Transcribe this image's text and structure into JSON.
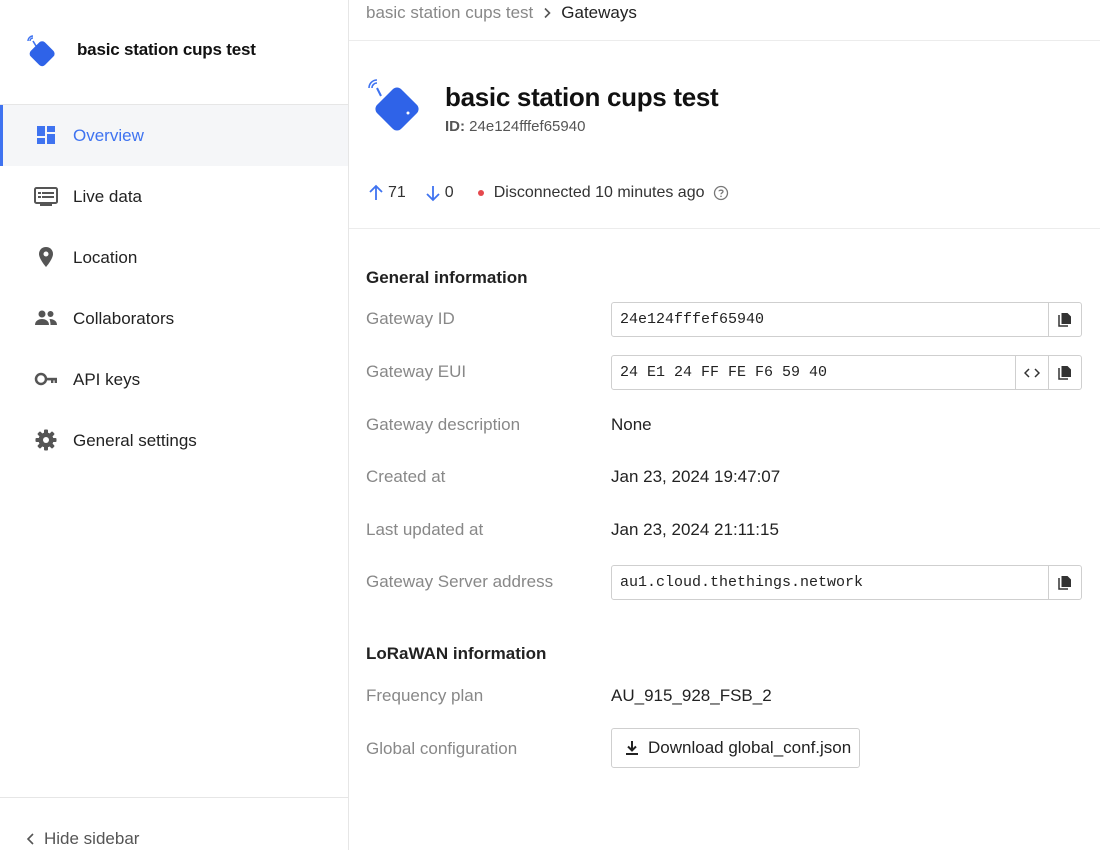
{
  "sidebar": {
    "title": "basic station cups test",
    "items": [
      {
        "label": "Overview",
        "icon": "overview-icon",
        "active": true
      },
      {
        "label": "Live data",
        "icon": "live-data-icon"
      },
      {
        "label": "Location",
        "icon": "location-pin-icon"
      },
      {
        "label": "Collaborators",
        "icon": "people-icon"
      },
      {
        "label": "API keys",
        "icon": "key-icon"
      },
      {
        "label": "General settings",
        "icon": "gear-icon"
      }
    ],
    "hide_label": "Hide sidebar"
  },
  "breadcrumb": {
    "parent": "basic station cups test",
    "current": "Gateways"
  },
  "gateway": {
    "title": "basic station cups test",
    "id_label": "ID:",
    "id_value": "24e124fffef65940",
    "uplink_count": "71",
    "downlink_count": "0",
    "status": "Disconnected 10 minutes ago"
  },
  "general": {
    "heading": "General information",
    "gateway_id_label": "Gateway ID",
    "gateway_id_value": "24e124fffef65940",
    "gateway_eui_label": "Gateway EUI",
    "gateway_eui_value": "24 E1 24 FF FE F6 59 40",
    "description_label": "Gateway description",
    "description_value": "None",
    "created_label": "Created at",
    "created_value": "Jan 23, 2024 19:47:07",
    "updated_label": "Last updated at",
    "updated_value": "Jan 23, 2024 21:11:15",
    "server_label": "Gateway Server address",
    "server_value": "au1.cloud.thethings.network"
  },
  "lorawan": {
    "heading": "LoRaWAN information",
    "freq_label": "Frequency plan",
    "freq_value": "AU_915_928_FSB_2",
    "global_label": "Global configuration",
    "download_label": "Download global_conf.json"
  },
  "colors": {
    "accent": "#3f73f0",
    "status_red": "#e5484d"
  }
}
